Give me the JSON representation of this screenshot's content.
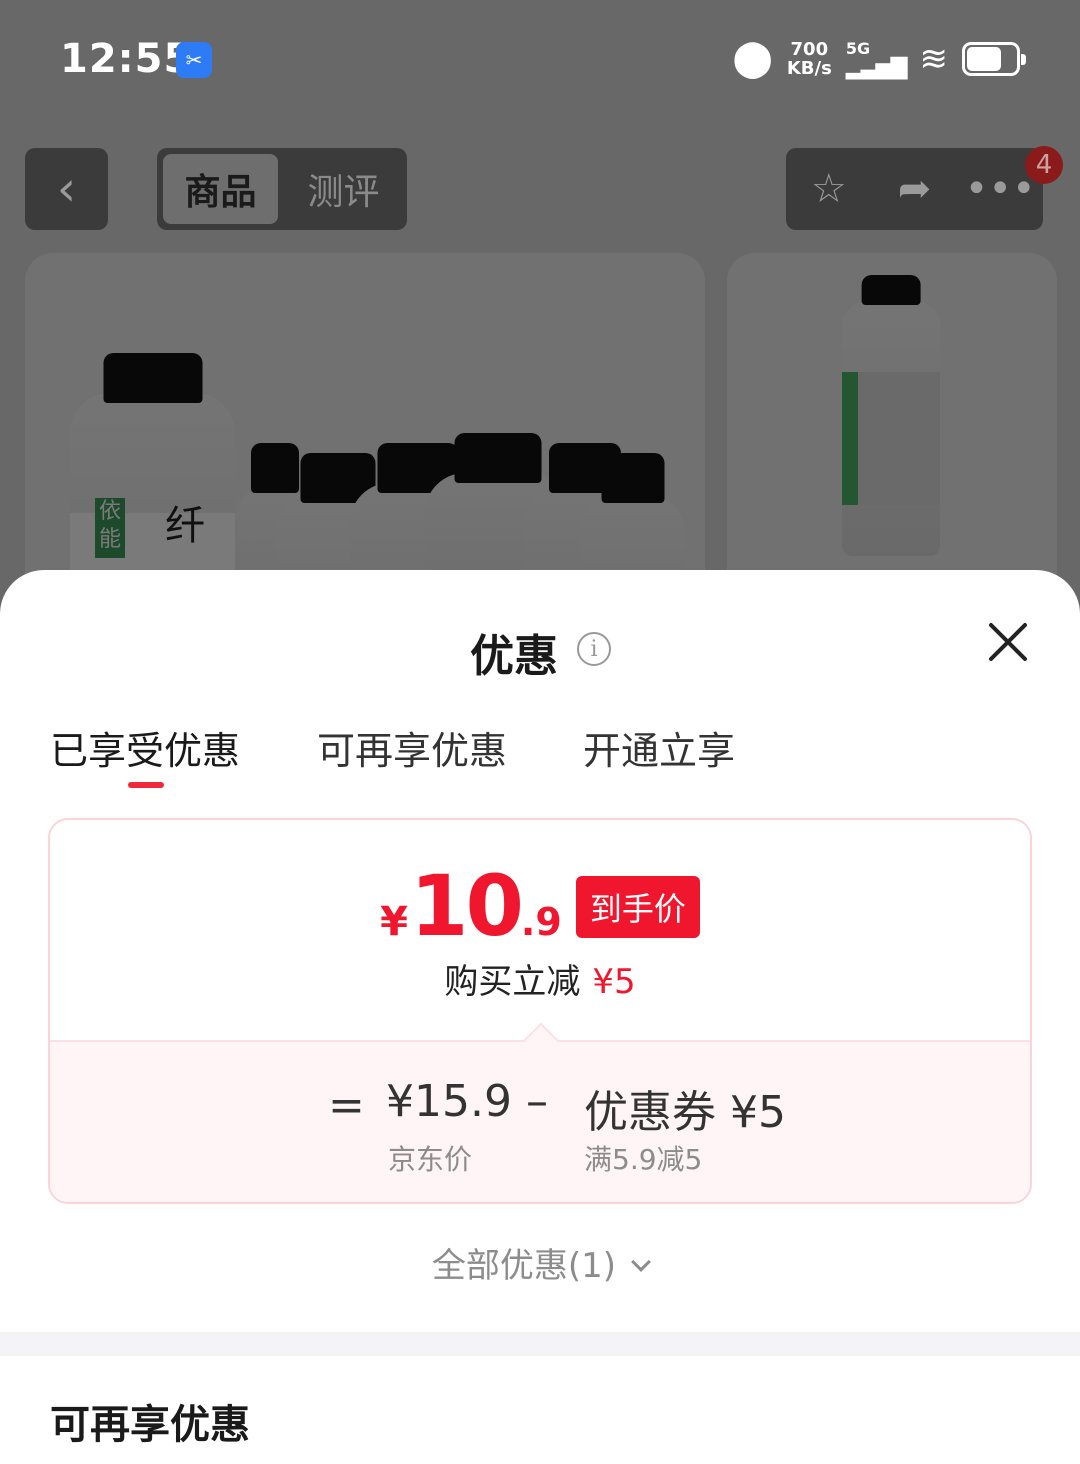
{
  "status_bar": {
    "time": "12:55",
    "app_icon": "screen-capture-icon",
    "speed_value": "700",
    "speed_unit": "KB/s",
    "network": "5G"
  },
  "nav": {
    "tabs": [
      {
        "label": "商品",
        "active": true
      },
      {
        "label": "测评",
        "active": false
      }
    ],
    "badge_count": "4",
    "icons": [
      "back-icon",
      "star-icon",
      "share-icon",
      "more-icon"
    ]
  },
  "background": {
    "product_label_chars": [
      "依能",
      "纤"
    ]
  },
  "sheet": {
    "title": "优惠",
    "tabs": [
      {
        "label": "已享受优惠",
        "active": true
      },
      {
        "label": "可再享优惠",
        "active": false
      },
      {
        "label": "开通立享",
        "active": false
      }
    ],
    "deal": {
      "currency": "¥",
      "price_integer": "10",
      "price_decimal": ".9",
      "price_tag": "到手价",
      "reduce_label": "购买立减",
      "reduce_amount": "¥5",
      "equals": "=",
      "base_price": "¥15.9",
      "base_price_label": "京东价",
      "minus": "–",
      "coupon": "优惠券 ¥5",
      "coupon_rule": "满5.9减5"
    },
    "all_deals_label": "全部优惠(1)",
    "section_title": "可再享优惠"
  },
  "colors": {
    "accent_red": "#f0162e",
    "card_border": "#fad4da"
  }
}
